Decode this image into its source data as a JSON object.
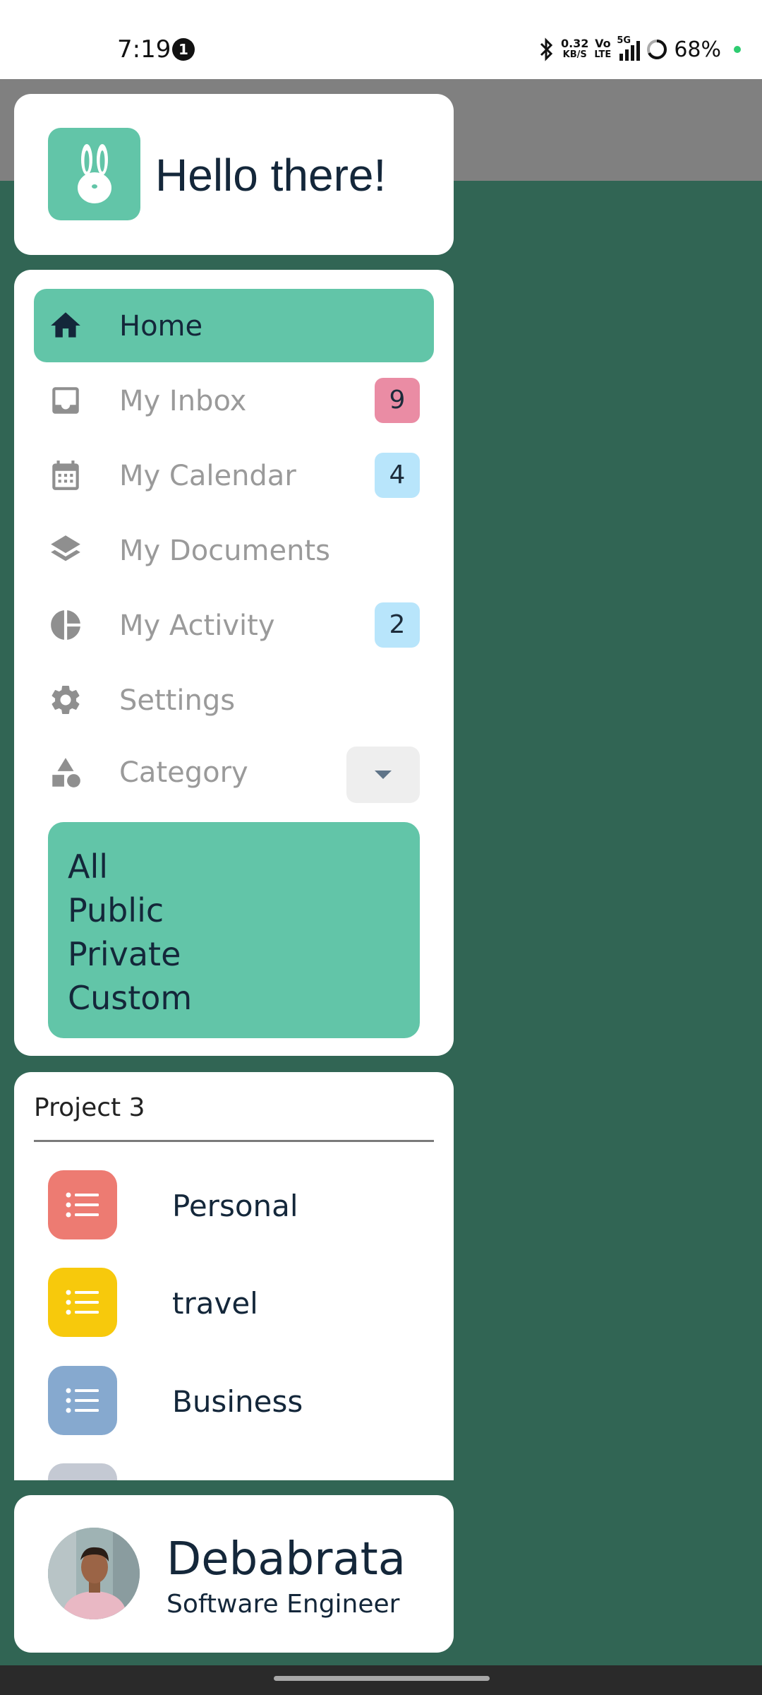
{
  "status_bar": {
    "time": "7:19",
    "notification_count": "1",
    "net_speed_value": "0.32",
    "net_speed_unit": "KB/S",
    "volte_top": "Vo",
    "volte_bottom": "LTE",
    "network": "5G",
    "battery": "68%"
  },
  "header": {
    "logo_icon": "rabbit-icon",
    "greeting": "Hello there!"
  },
  "nav": {
    "items": [
      {
        "label": "Home",
        "icon": "home-icon",
        "active": true
      },
      {
        "label": "My Inbox",
        "icon": "inbox-icon",
        "badge": "9",
        "badge_color": "#ea8ca4"
      },
      {
        "label": "My Calendar",
        "icon": "calendar-icon",
        "badge": "4",
        "badge_color": "#b8e5fb"
      },
      {
        "label": "My Documents",
        "icon": "layers-icon"
      },
      {
        "label": "My Activity",
        "icon": "pie-chart-icon",
        "badge": "2",
        "badge_color": "#b8e5fb"
      },
      {
        "label": "Settings",
        "icon": "gear-icon"
      }
    ],
    "category": {
      "label": "Category",
      "icon": "shapes-icon",
      "options": [
        "All",
        "Public",
        "Private",
        "Custom"
      ]
    }
  },
  "projects": {
    "title": "Project 3",
    "items": [
      {
        "label": "Personal",
        "icon": "list-icon",
        "color": "#ed7b72"
      },
      {
        "label": "travel",
        "icon": "list-icon",
        "color": "#f7c90c"
      },
      {
        "label": "Business",
        "icon": "list-icon",
        "color": "#86a9cf"
      }
    ]
  },
  "profile": {
    "name": "Debabrata",
    "role": "Software Engineer"
  },
  "colors": {
    "accent": "#62c5a8",
    "background": "#316554",
    "text_dark": "#14273a",
    "text_muted": "#9a9a9a"
  }
}
